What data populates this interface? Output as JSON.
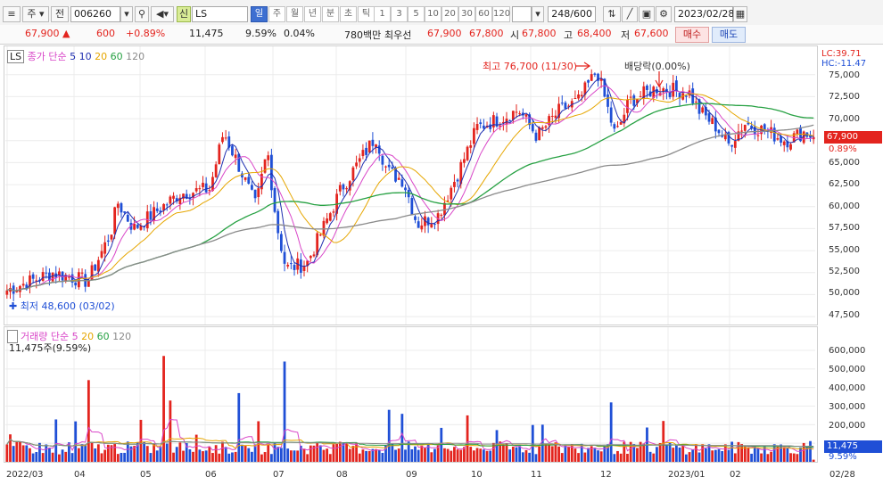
{
  "toolbar": {
    "market_btn": "주",
    "jeon_btn": "전",
    "code": "006260",
    "new_badge": "신",
    "name": "LS",
    "periods": [
      "일",
      "주",
      "월",
      "년",
      "분",
      "초",
      "틱"
    ],
    "minutes": [
      "1",
      "3",
      "5",
      "10",
      "20",
      "30",
      "60",
      "120"
    ],
    "count": "248/600",
    "date": "2023/02/28"
  },
  "quote": {
    "price": "67,900",
    "change": "600",
    "change_pct": "+0.89%",
    "volume": "11,475",
    "vol_ratio": "9.59%",
    "turnover_pct": "0.04%",
    "amount": "780백만",
    "best_label": "최우선",
    "ask": "67,900",
    "bid": "67,800",
    "open_label": "시",
    "open": "67,800",
    "high_label": "고",
    "high": "68,400",
    "low_label": "저",
    "low": "67,600",
    "buy": "매수",
    "sell": "매도"
  },
  "price_pane": {
    "tag": "LS",
    "legend_title": "종가 단순",
    "ma": [
      "5",
      "10",
      "20",
      "60",
      "120"
    ],
    "lc": "LC:39.71",
    "hc": "HC:-11.47",
    "high_note": "최고 76,700 (11/30)",
    "low_note": "최저 48,600 (03/02)",
    "div_note": "배당락(0.00%)",
    "cur_price": "67,900",
    "cur_pct": "0.89%",
    "y_labels": [
      "75,000",
      "72,500",
      "70,000",
      "67,500",
      "65,000",
      "62,500",
      "60,000",
      "57,500",
      "55,000",
      "52,500",
      "50,000",
      "47,500"
    ]
  },
  "vol_pane": {
    "legend_title": "거래량 단순",
    "ma": [
      "5",
      "20",
      "60",
      "120"
    ],
    "sub": "11,475주(9.59%)",
    "y_labels": [
      "600,000",
      "500,000",
      "400,000",
      "300,000",
      "200,000",
      "100,000"
    ],
    "cur_vol": "11,475",
    "cur_pct": "9.59%"
  },
  "x_labels": [
    "2022/03",
    "04",
    "05",
    "06",
    "07",
    "08",
    "09",
    "10",
    "11",
    "12",
    "2023/01",
    "02"
  ],
  "x_last": "02/28",
  "colors": {
    "up": "#e3241e",
    "down": "#1f4fd6",
    "ma5": "#1f2fb0",
    "ma10": "#d946c8",
    "ma20": "#e6a600",
    "ma60": "#27a143",
    "ma120": "#8a8a8a"
  }
}
